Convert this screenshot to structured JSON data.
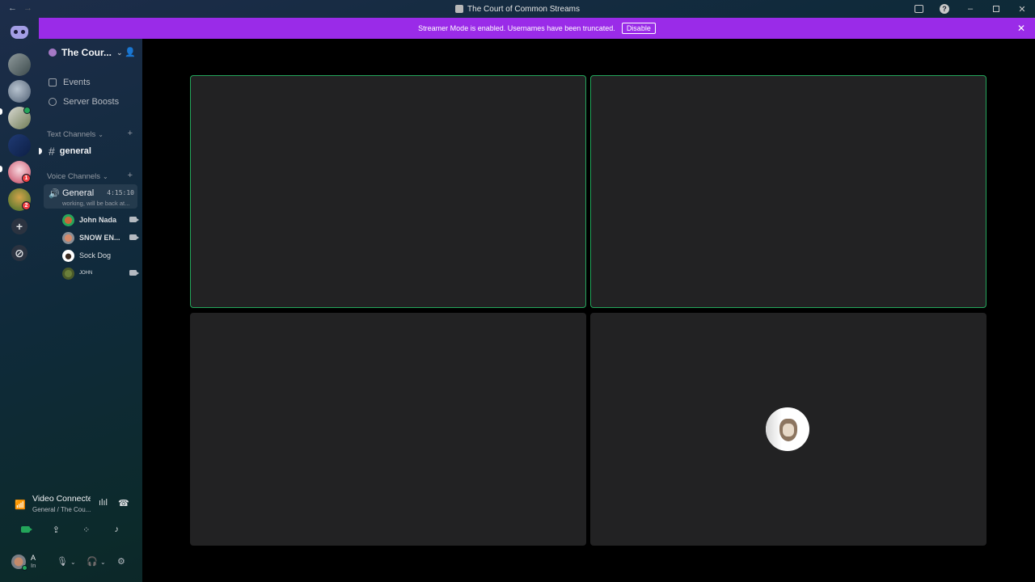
{
  "window": {
    "title": "The Court of Common Streams"
  },
  "banner": {
    "text": "Streamer Mode is enabled. Usernames have been truncated.",
    "disable_label": "Disable"
  },
  "rail": {
    "badges": [
      "1",
      "2"
    ]
  },
  "server": {
    "name": "The Cour..."
  },
  "sidebar": {
    "events_label": "Events",
    "boosts_label": "Server Boosts",
    "text_category": "Text Channels",
    "text_channels": [
      {
        "name": "general"
      }
    ],
    "voice_category": "Voice Channels",
    "voice_channel": {
      "name": "General",
      "timer": "4:15:10",
      "status": "working, will be back at..."
    },
    "voice_users": [
      {
        "name": "John Nada",
        "video": true
      },
      {
        "name": "SNOW EN...",
        "video": true
      },
      {
        "name": "Sock Dog",
        "video": false
      },
      {
        "name": "JOHN",
        "video": true
      }
    ]
  },
  "voice_panel": {
    "title": "Video Connected",
    "subtitle": "General / The Cou..."
  },
  "user_bar": {
    "name": "A",
    "status": "In"
  },
  "colors": {
    "banner": "#9a2be8",
    "speaking": "#23a55a",
    "badge": "#f23f43",
    "tile": "#222223"
  },
  "video_grid": {
    "tiles": [
      {
        "speaking": true
      },
      {
        "speaking": true
      },
      {
        "speaking": false
      },
      {
        "speaking": false,
        "avatar_icon": "sock-dog-avatar"
      }
    ]
  }
}
